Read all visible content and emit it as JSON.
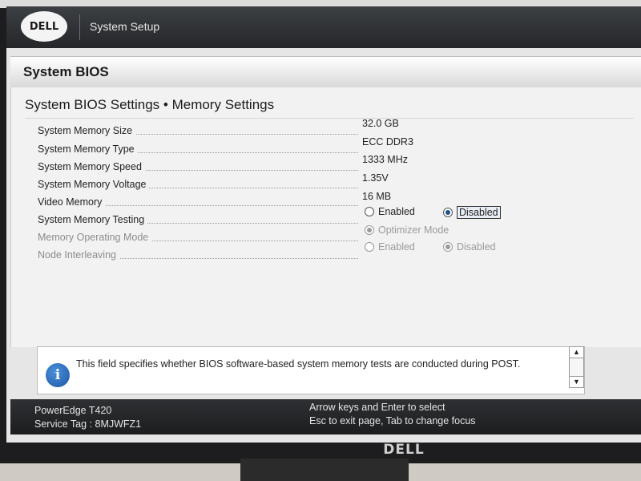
{
  "header": {
    "logo": "DELL",
    "app_title": "System Setup"
  },
  "section": {
    "title": "System BIOS"
  },
  "page": {
    "title": "System BIOS Settings • Memory Settings"
  },
  "fields": [
    {
      "label": "System Memory Size",
      "value": "32.0 GB"
    },
    {
      "label": "System Memory Type",
      "value": "ECC DDR3"
    },
    {
      "label": "System Memory Speed",
      "value": "1333 MHz"
    },
    {
      "label": "System Memory Voltage",
      "value": "1.35V"
    },
    {
      "label": "Video Memory",
      "value": "16 MB"
    }
  ],
  "memory_testing": {
    "label": "System Memory Testing",
    "options": [
      "Enabled",
      "Disabled"
    ],
    "selected": "Disabled"
  },
  "memory_operating_mode": {
    "label": "Memory Operating Mode",
    "option": "Optimizer Mode",
    "selected": "Optimizer Mode"
  },
  "node_interleaving": {
    "label": "Node Interleaving",
    "options": [
      "Enabled",
      "Disabled"
    ],
    "selected": "Disabled"
  },
  "help": {
    "icon": "info-icon",
    "text": "This field specifies whether BIOS software-based system memory tests are conducted during POST."
  },
  "footer": {
    "model": "PowerEdge T420",
    "service_tag": "Service Tag : 8MJWFZ1",
    "hint_line1": "Arrow keys and Enter to select",
    "hint_line2": "Esc to exit page, Tab to change focus"
  },
  "monitor_brand": "DELL",
  "colors": {
    "accent": "#1f4f8c",
    "topbar": "#2e3033",
    "page_bg": "#f2f2f2"
  }
}
